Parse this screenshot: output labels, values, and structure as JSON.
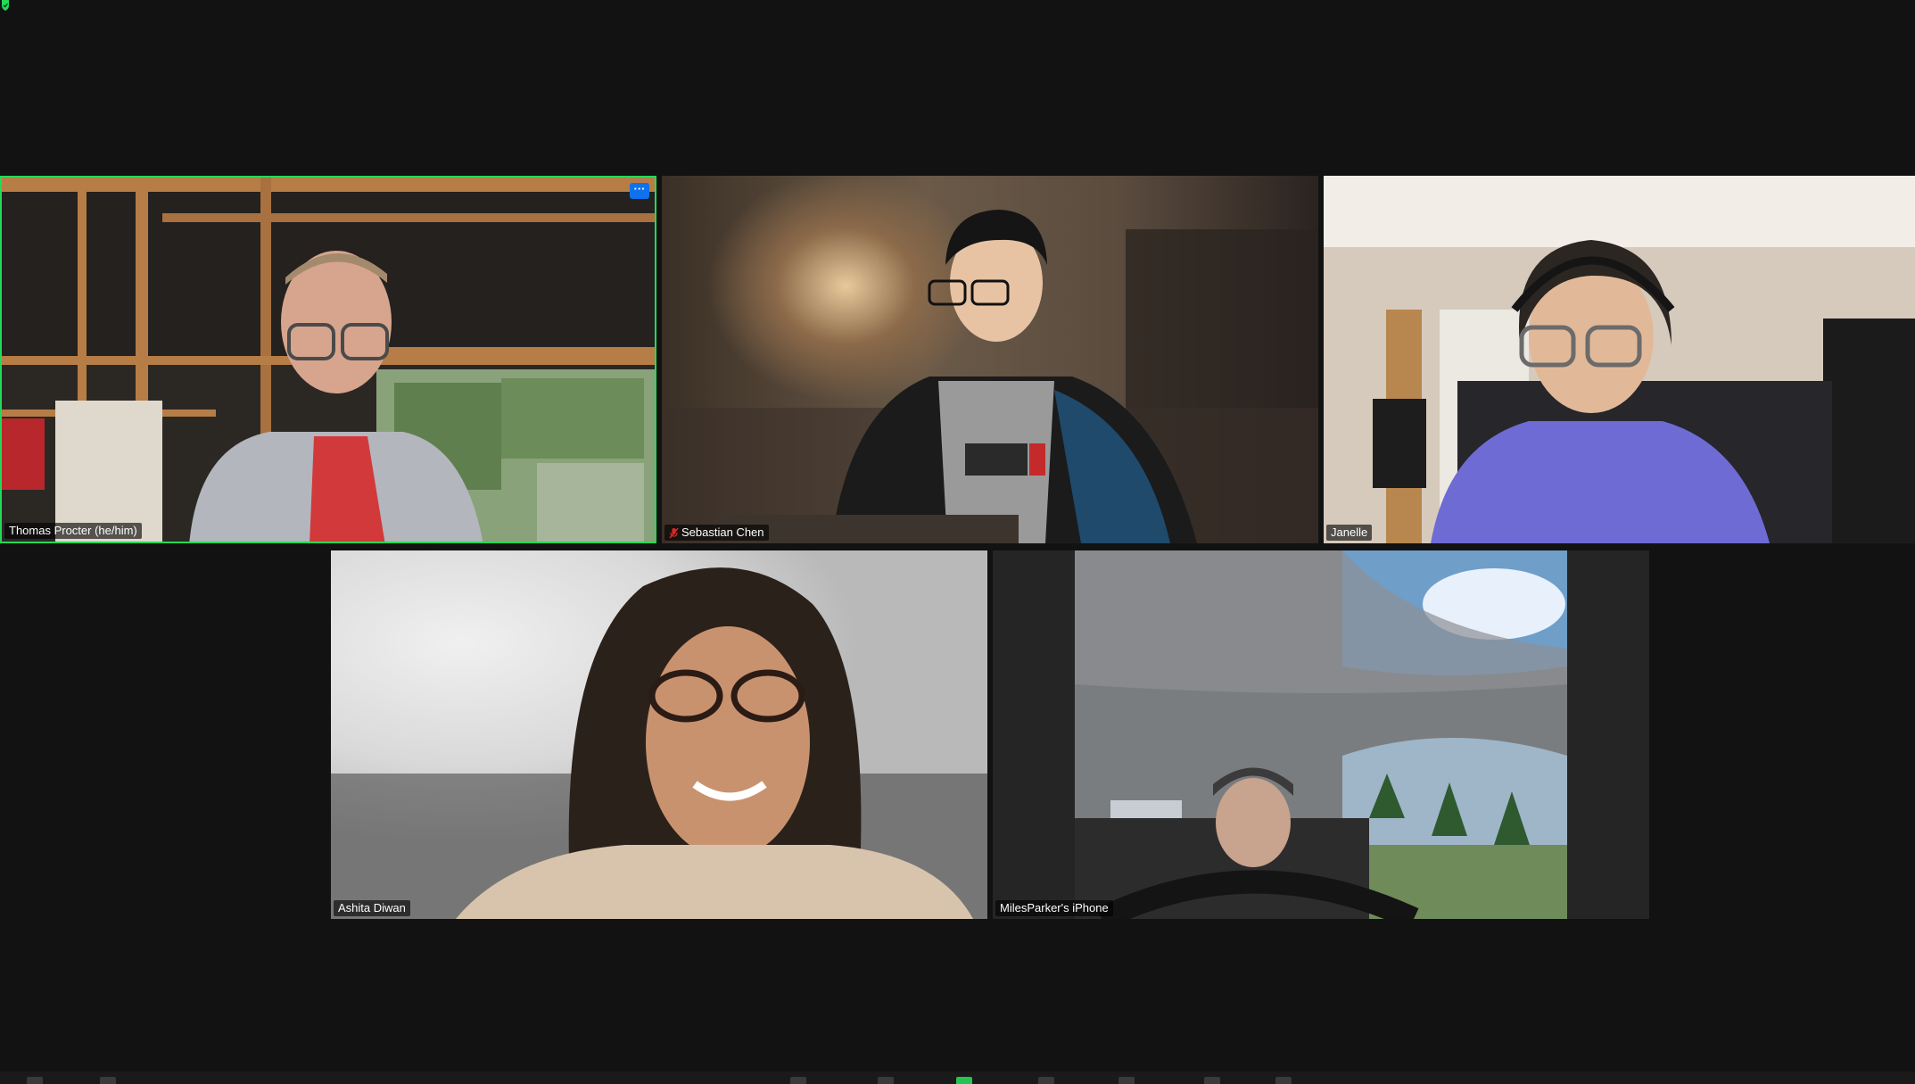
{
  "window": {
    "encryption_icon": "shield-check-icon",
    "accent_color": "#23d959"
  },
  "participants": [
    {
      "name": "Thomas Procter (he/him)",
      "active_speaker": true,
      "muted": false,
      "more_label": "···"
    },
    {
      "name": "Sebastian Chen",
      "active_speaker": false,
      "muted": true
    },
    {
      "name": "Janelle",
      "active_speaker": false,
      "muted": false
    },
    {
      "name": "Ashita Diwan",
      "active_speaker": false,
      "muted": false
    },
    {
      "name": "MilesParker's iPhone",
      "active_speaker": false,
      "muted": false
    }
  ],
  "toolbar": {
    "items": [
      {
        "icon": "mute-mic-icon"
      },
      {
        "icon": "stop-video-icon"
      },
      {
        "icon": "participants-icon"
      },
      {
        "icon": "chat-icon"
      },
      {
        "icon": "share-screen-icon"
      },
      {
        "icon": "record-icon"
      },
      {
        "icon": "reactions-icon"
      },
      {
        "icon": "apps-icon"
      },
      {
        "icon": "more-icon"
      }
    ],
    "share_color": "#23c552"
  }
}
